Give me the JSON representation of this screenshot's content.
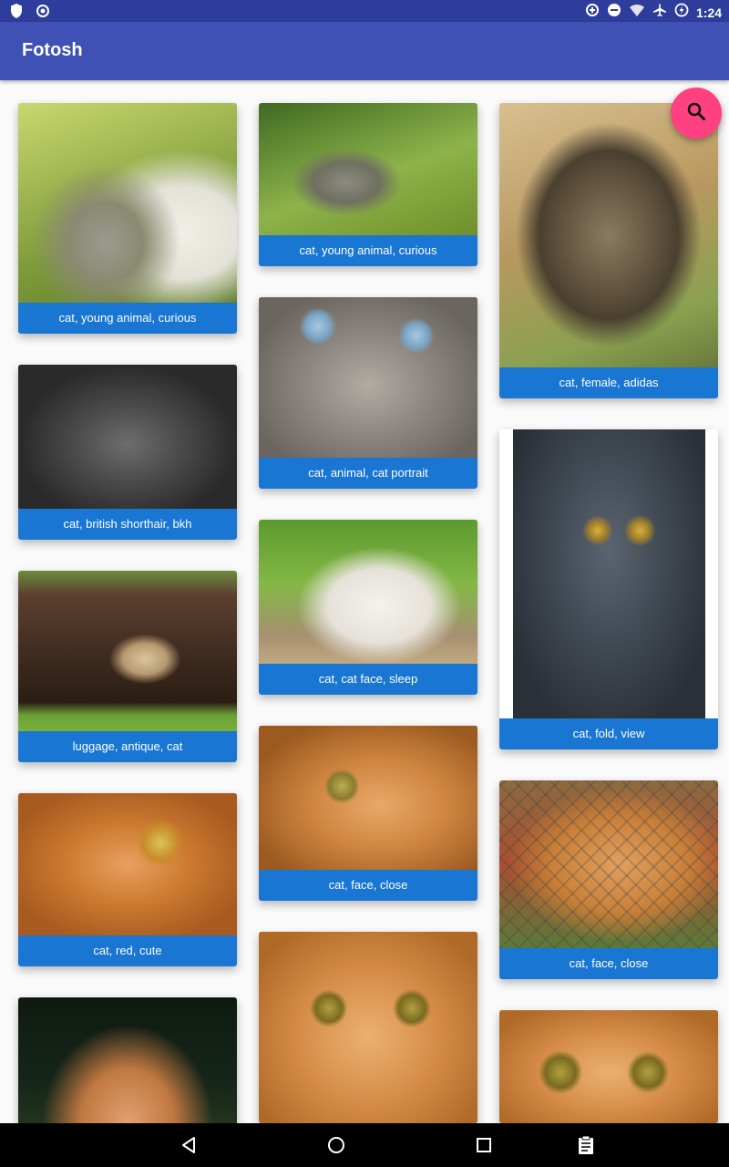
{
  "status": {
    "time": "1:24",
    "left_icons": [
      "shield-icon",
      "circle-dot-icon"
    ],
    "right_icons": [
      "data-saver-icon",
      "do-not-disturb-icon",
      "wifi-icon",
      "airplane-icon",
      "battery-charging-icon"
    ]
  },
  "app": {
    "title": "Fotosh"
  },
  "fab": {
    "icon": "search-icon",
    "color": "#ff4081"
  },
  "theme": {
    "primary": "#3f51b5",
    "primary_dark": "#2e3d9c",
    "caption_bg": "#1976d2",
    "accent": "#ff4081"
  },
  "cards": [
    {
      "caption": "cat, young animal, curious"
    },
    {
      "caption": "cat, british shorthair, bkh"
    },
    {
      "caption": "luggage, antique, cat"
    },
    {
      "caption": "cat, red, cute"
    },
    {
      "caption": ""
    },
    {
      "caption": "cat, young animal, curious"
    },
    {
      "caption": "cat, animal, cat portrait"
    },
    {
      "caption": "cat, cat face, sleep"
    },
    {
      "caption": "cat, face, close"
    },
    {
      "caption": ""
    },
    {
      "caption": "cat, female, adidas"
    },
    {
      "caption": "cat, fold, view"
    },
    {
      "caption": "cat, face, close"
    },
    {
      "caption": ""
    }
  ],
  "nav": {
    "icons": [
      "back-icon",
      "home-icon",
      "recents-icon",
      "clipboard-icon"
    ]
  }
}
